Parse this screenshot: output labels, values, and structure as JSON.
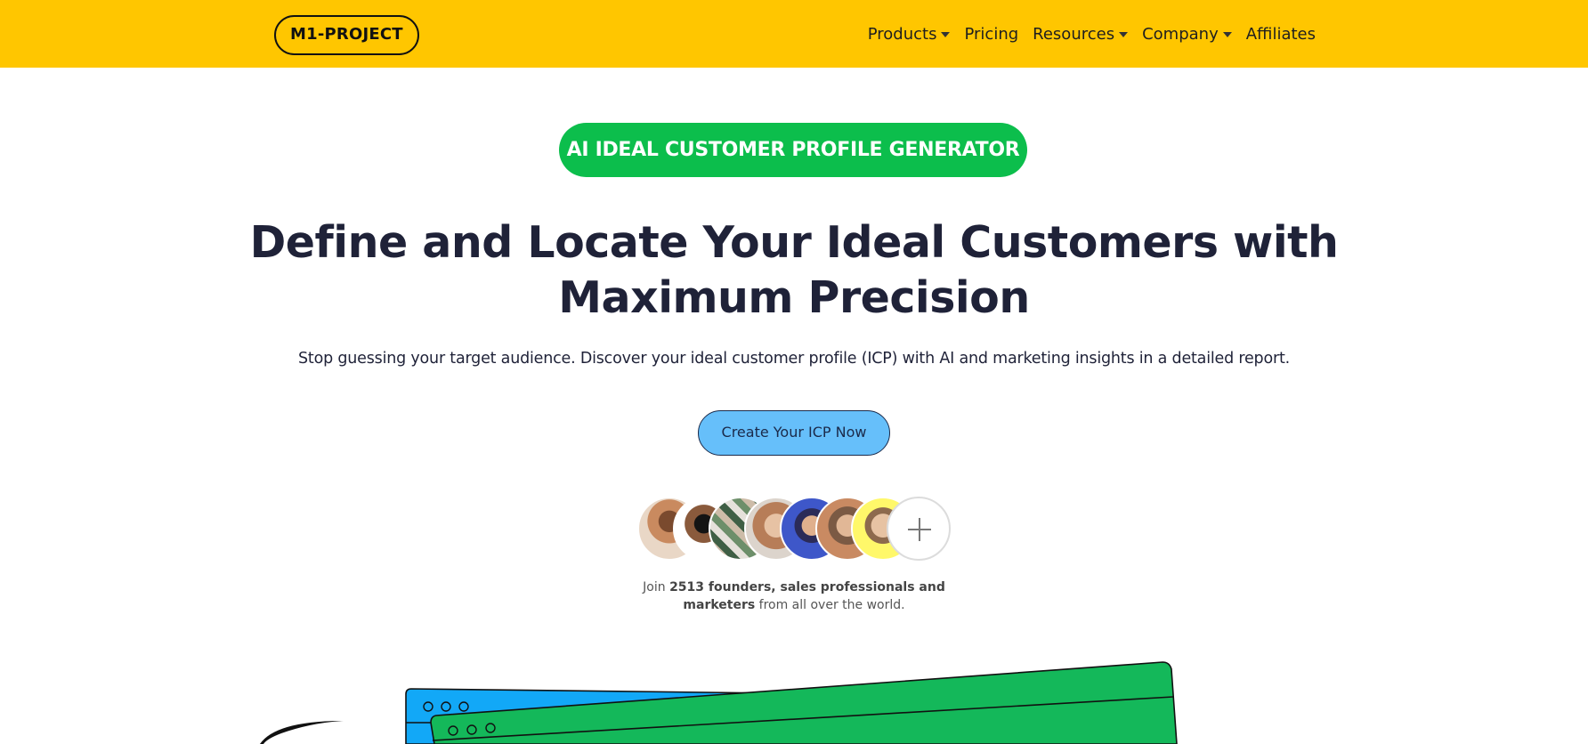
{
  "brand": {
    "logo": "M1-PROJECT",
    "accent": "#ffc600"
  },
  "nav": {
    "items": [
      {
        "label": "Products",
        "dropdown": true
      },
      {
        "label": "Pricing",
        "dropdown": false
      },
      {
        "label": "Resources",
        "dropdown": true
      },
      {
        "label": "Company",
        "dropdown": true
      },
      {
        "label": "Affiliates",
        "dropdown": false
      }
    ]
  },
  "hero": {
    "badge": "AI IDEAL CUSTOMER PROFILE GENERATOR",
    "title": "Define and Locate Your Ideal Customers with Maximum Precision",
    "subtitle": "Stop guessing your target audience. Discover your ideal customer profile (ICP) with AI and marketing insights in a detailed report.",
    "cta_label": "Create Your ICP Now",
    "colors": {
      "badge": "#0cbe4c",
      "cta": "#66bffa"
    }
  },
  "social_proof": {
    "avatar_count": 7,
    "join_prefix": "Join ",
    "join_bold": "2513 founders, sales professionals and marketers",
    "join_suffix": " from all over the world."
  },
  "icons": [
    "chevron-down-icon",
    "plus-icon"
  ]
}
